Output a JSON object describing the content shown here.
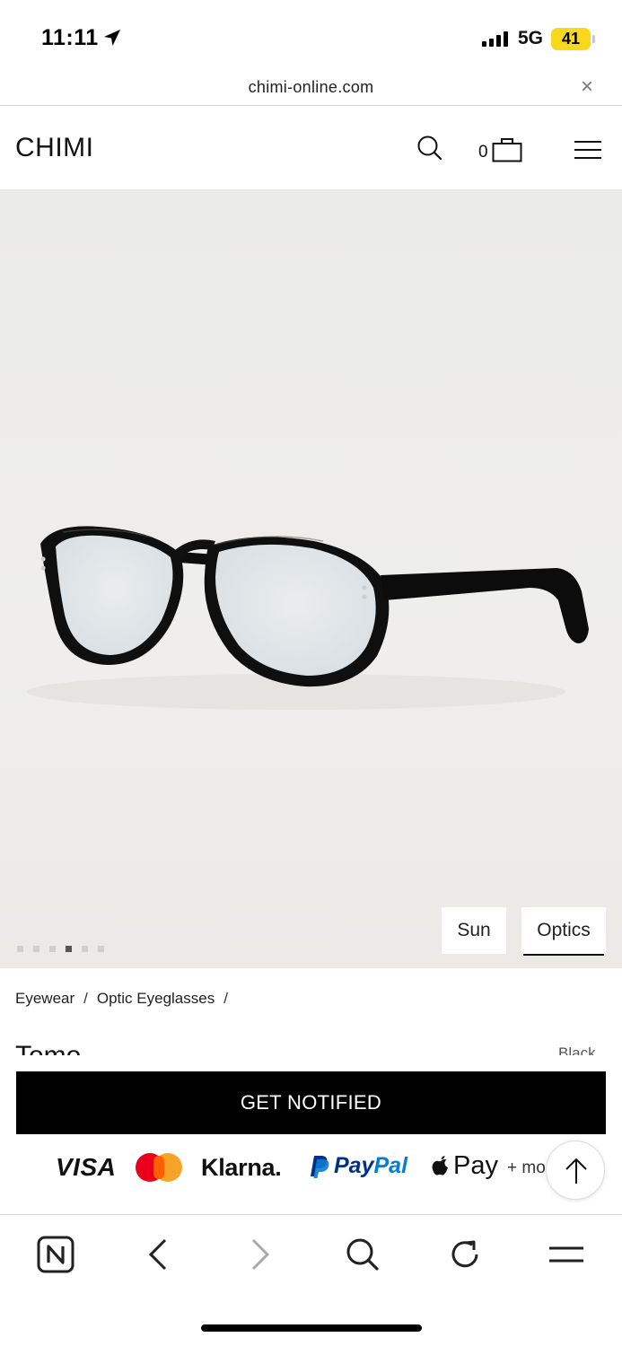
{
  "status_bar": {
    "time": "11:11",
    "network": "5G",
    "battery": "41"
  },
  "browser": {
    "url": "chimi-online.com",
    "close_glyph": "×"
  },
  "header": {
    "logo": "CHIMI",
    "cart_count": "0",
    "icons": [
      "search-icon",
      "shopping-bag-icon",
      "hamburger-menu-icon"
    ]
  },
  "gallery": {
    "slide_count": 6,
    "active_slide": 4,
    "toggle": {
      "sun_label": "Sun",
      "optics_label": "Optics",
      "selected": "Optics"
    }
  },
  "breadcrumb": {
    "items": [
      "Eyewear",
      "Optic Eyeglasses"
    ],
    "separator": "/"
  },
  "product": {
    "name_partial": "Tomo",
    "color_partial": "Black"
  },
  "cta": {
    "label": "GET NOTIFIED"
  },
  "payments": {
    "visa": "VISA",
    "klarna": "Klarna.",
    "paypal_a": "Pay",
    "paypal_b": "Pal",
    "apple_pay": "Pay",
    "more": "+ more"
  },
  "toolbar": {
    "icons": [
      "n-logo-icon",
      "back-icon",
      "forward-icon",
      "search-icon",
      "reload-icon",
      "menu-icon"
    ]
  },
  "colors": {
    "accent": "#000000",
    "battery": "#f8d81c",
    "hero_bg": "#ecebe9"
  }
}
